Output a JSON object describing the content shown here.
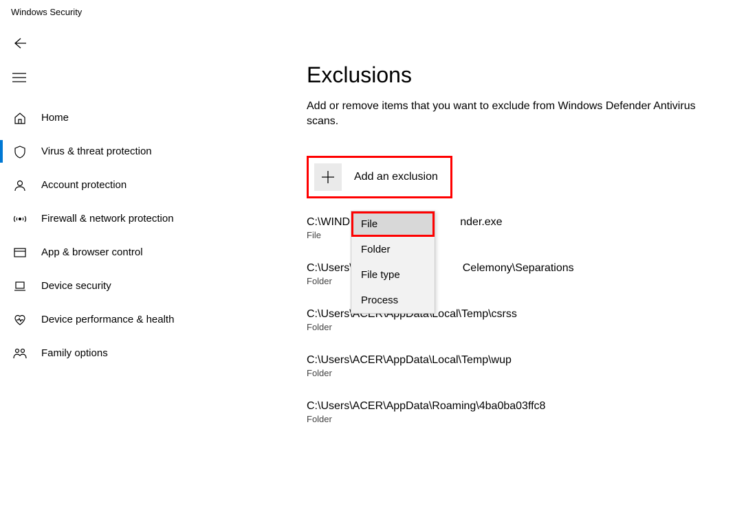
{
  "window_title": "Windows Security",
  "sidebar": {
    "items": [
      {
        "label": "Home"
      },
      {
        "label": "Virus & threat protection"
      },
      {
        "label": "Account protection"
      },
      {
        "label": "Firewall & network protection"
      },
      {
        "label": "App & browser control"
      },
      {
        "label": "Device security"
      },
      {
        "label": "Device performance & health"
      },
      {
        "label": "Family options"
      }
    ]
  },
  "main": {
    "title": "Exclusions",
    "description": "Add or remove items that you want to exclude from Windows Defender Antivirus scans.",
    "add_button": "Add an exclusion",
    "exclusions": [
      {
        "path": "C:\\WINDOWS\\system32\\Defender.exe",
        "path_visible_prefix": "C:\\WIND",
        "path_visible_suffix": "nder.exe",
        "type": "File"
      },
      {
        "path": "C:\\Users\\ACER\\AppData\\Local\\Celemony\\Separations",
        "path_visible_prefix": "C:\\Users\\",
        "path_visible_suffix": "Celemony\\Separations",
        "type": "Folder"
      },
      {
        "path": "C:\\Users\\ACER\\AppData\\Local\\Temp\\csrss",
        "type": "Folder"
      },
      {
        "path": "C:\\Users\\ACER\\AppData\\Local\\Temp\\wup",
        "type": "Folder"
      },
      {
        "path": "C:\\Users\\ACER\\AppData\\Roaming\\4ba0ba03ffc8",
        "type": "Folder"
      }
    ]
  },
  "dropdown": {
    "items": [
      {
        "label": "File"
      },
      {
        "label": "Folder"
      },
      {
        "label": "File type"
      },
      {
        "label": "Process"
      }
    ]
  }
}
